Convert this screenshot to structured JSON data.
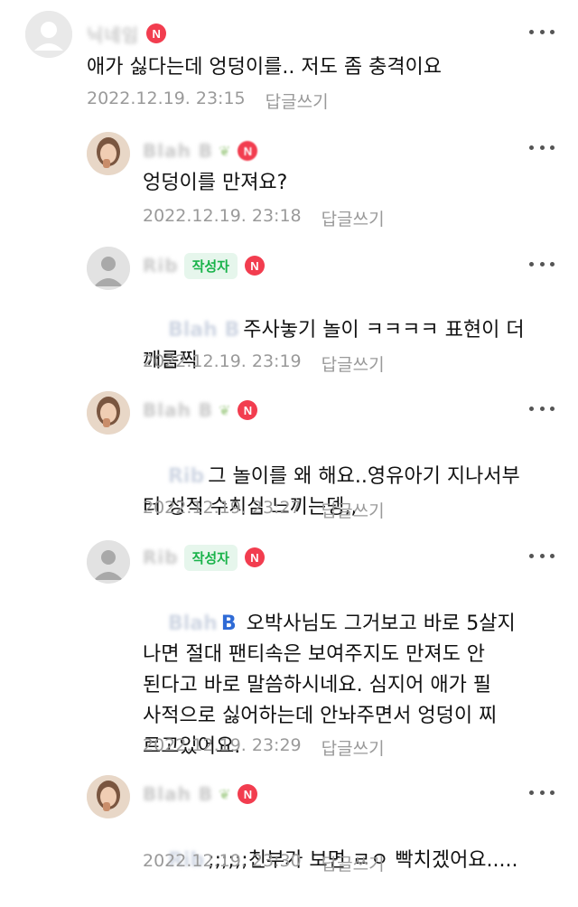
{
  "comments": [
    {
      "author": "닉네임",
      "text": "애가 싫다는데 엉덩이를.. 저도 좀 충격이요",
      "date": "2022.12.19. 23:15",
      "reply_label": "답글쓰기",
      "badge_n": "N"
    },
    {
      "author": "Blah B",
      "text": "엉덩이를 만져요?",
      "date": "2022.12.19. 23:18",
      "reply_label": "답글쓰기",
      "badge_n": "N"
    },
    {
      "author": "Rib",
      "writer_badge": "작성자",
      "badge_n": "N",
      "mention": "Blah B",
      "text": "주사놓기 놀이 ㅋㅋㅋㅋ 표현이 더",
      "text2": "깨름찍",
      "date": "2022.12.19. 23:19",
      "reply_label": "답글쓰기"
    },
    {
      "author": "Blah B",
      "badge_n": "N",
      "mention": "Rib",
      "text": "그 놀이를 왜 해요..영유아기 지나서부",
      "text2": "터 성적 수치심 느끼는뎅,,",
      "date": "2022.12.19. 23:27",
      "reply_label": "답글쓰기"
    },
    {
      "author": "Rib",
      "writer_badge": "작성자",
      "badge_n": "N",
      "mention_prefix": "Blah",
      "mention_suffix": "B",
      "text": "오박사님도 그거보고 바로 5살지",
      "lines": [
        "나면 절대 팬티속은 보여주지도 만져도 안",
        "된다고 바로 말씀하시네요. 심지어 애가 필",
        "사적으로 싫어하는데 안놔주면서 엉덩이 찌",
        "르고있어요."
      ],
      "date": "2022.12.19. 23:29",
      "reply_label": "답글쓰기"
    },
    {
      "author": "Blah B",
      "badge_n": "N",
      "mention": "Rib",
      "text": ";;;;;;친부가 보면 ㄹㅇ 빡치겠어요.....",
      "date": "2022.12.19. 23:30",
      "reply_label": "답글쓰기"
    }
  ],
  "icons": {
    "more": "more-vertical-dots-icon",
    "avatar_default": "default-user-avatar-icon",
    "grade": "sprout-grade-icon",
    "new": "new-n-badge-icon"
  },
  "colors": {
    "writer_badge_bg": "#e6f6ec",
    "writer_badge_text": "#19b34a",
    "new_badge": "#f23d4f",
    "mention_blue": "#2f6bd6"
  }
}
